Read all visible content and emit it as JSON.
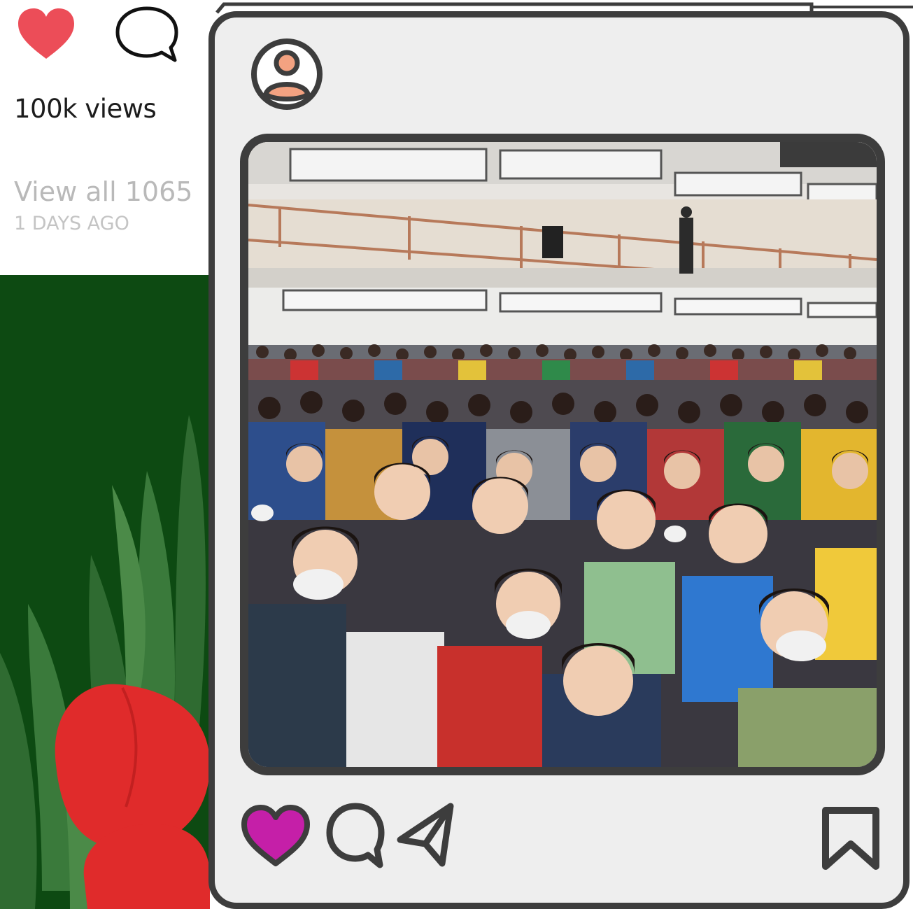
{
  "background_post": {
    "views_text": "100k views",
    "view_all_text": "View all 1065",
    "time_ago": "1 DAYS AGO",
    "icons": [
      "heart-icon",
      "comment-icon"
    ]
  },
  "main_post": {
    "icons": [
      "avatar-icon",
      "like-heart-icon",
      "comment-icon",
      "share-icon",
      "bookmark-icon"
    ],
    "photo_description_icon": "crowd-photo"
  },
  "colors": {
    "heart_red": "#ec4d58",
    "like_magenta": "#c51fa8",
    "frame_dark": "#3d3d3d",
    "frame_bg": "#eeeeee",
    "avatar_accent": "#f3a281",
    "green_panel": "#0d4a12",
    "tulip_red": "#e02b2b"
  }
}
